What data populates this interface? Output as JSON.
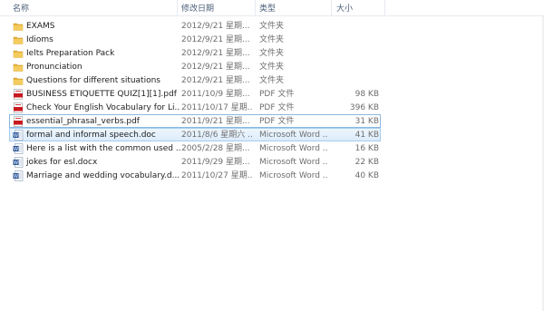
{
  "columns": {
    "name": "名称",
    "date": "修改日期",
    "type": "类型",
    "size": "大小"
  },
  "files": [
    {
      "name": "EXAMS",
      "date": "2012/9/21 星期...",
      "type": "文件夹",
      "size": "",
      "icon": "folder-icon"
    },
    {
      "name": "Idioms",
      "date": "2012/9/21 星期...",
      "type": "文件夹",
      "size": "",
      "icon": "folder-icon"
    },
    {
      "name": "Ielts Preparation Pack",
      "date": "2012/9/21 星期...",
      "type": "文件夹",
      "size": "",
      "icon": "folder-icon"
    },
    {
      "name": "Pronunciation",
      "date": "2012/9/21 星期...",
      "type": "文件夹",
      "size": "",
      "icon": "folder-icon"
    },
    {
      "name": "Questions for different situations",
      "date": "2012/9/21 星期...",
      "type": "文件夹",
      "size": "",
      "icon": "folder-icon"
    },
    {
      "name": "BUSINESS ETIQUETTE QUIZ[1][1].pdf",
      "date": "2011/10/9 星期...",
      "type": "PDF 文件",
      "size": "98 KB",
      "icon": "pdf-icon"
    },
    {
      "name": "Check Your English Vocabulary for Li...",
      "date": "2011/10/17 星期...",
      "type": "PDF 文件",
      "size": "396 KB",
      "icon": "pdf-icon"
    },
    {
      "name": "essential_phrasal_verbs.pdf",
      "date": "2011/9/21 星期...",
      "type": "PDF 文件",
      "size": "31 KB",
      "icon": "pdf-icon"
    },
    {
      "name": "formal and informal speech.doc",
      "date": "2011/8/6 星期六 ...",
      "type": "Microsoft Word ...",
      "size": "41 KB",
      "icon": "word-icon"
    },
    {
      "name": "Here is a list with the common used ...",
      "date": "2005/2/28 星期...",
      "type": "Microsoft Word ...",
      "size": "16 KB",
      "icon": "word-icon"
    },
    {
      "name": "jokes for esl.docx",
      "date": "2011/9/29 星期...",
      "type": "Microsoft Word ...",
      "size": "22 KB",
      "icon": "word-icon"
    },
    {
      "name": "Marriage and wedding vocabulary.d...",
      "date": "2011/10/27 星期...",
      "type": "Microsoft Word ...",
      "size": "40 KB",
      "icon": "word-icon"
    }
  ],
  "focused_index": 7,
  "selected_index": 8,
  "colors": {
    "folder": "#e8b43a",
    "pdf": "#c8191f",
    "word": "#2a5699",
    "selection": "#dcecfb"
  }
}
